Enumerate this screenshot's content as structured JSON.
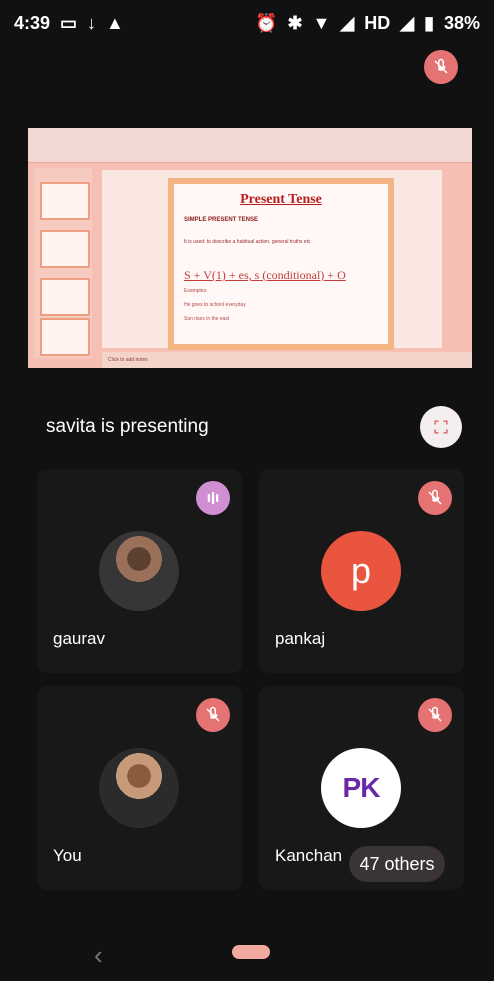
{
  "status": {
    "time": "4:39",
    "icons_left": [
      "video-icon",
      "download-icon",
      "warning-icon"
    ],
    "icons_right": [
      "alarm-icon",
      "bluetooth-icon",
      "wifi-icon",
      "signal-icon",
      "signal-icon",
      "battery-icon"
    ],
    "hd_label": "HD",
    "battery_percent": "38%"
  },
  "presentation": {
    "slide_title": "Present Tense",
    "slide_subtitle": "SIMPLE PRESENT TENSE",
    "slide_line": "It is used: to describe a habitual action, general truths etc",
    "slide_formula": "S + V(1) + es, s (conditional) + O",
    "slide_example_1": "Examples:",
    "slide_example_2": "He goes to school everyday",
    "slide_example_3": "Sun rises in the east",
    "slide_footer": "Click to add notes"
  },
  "presenting": {
    "label": "savita is presenting"
  },
  "participants": [
    {
      "name": "gaurav",
      "avatar_type": "photo",
      "status": "speaking"
    },
    {
      "name": "pankaj",
      "avatar_type": "letter",
      "letter": "p",
      "status": "muted"
    },
    {
      "name": "You",
      "avatar_type": "photo",
      "status": "muted"
    },
    {
      "name": "Kanchan",
      "avatar_type": "logo",
      "logo_text": "PK",
      "status": "muted"
    }
  ],
  "others": {
    "label": "47 others"
  },
  "colors": {
    "background": "#111111",
    "muted_badge": "#e57373",
    "speaking_badge": "#d08fd3",
    "pankaj_avatar": "#ea5540"
  },
  "nav": {
    "back_icon": "back-icon",
    "home_icon": "home-pill-icon"
  }
}
